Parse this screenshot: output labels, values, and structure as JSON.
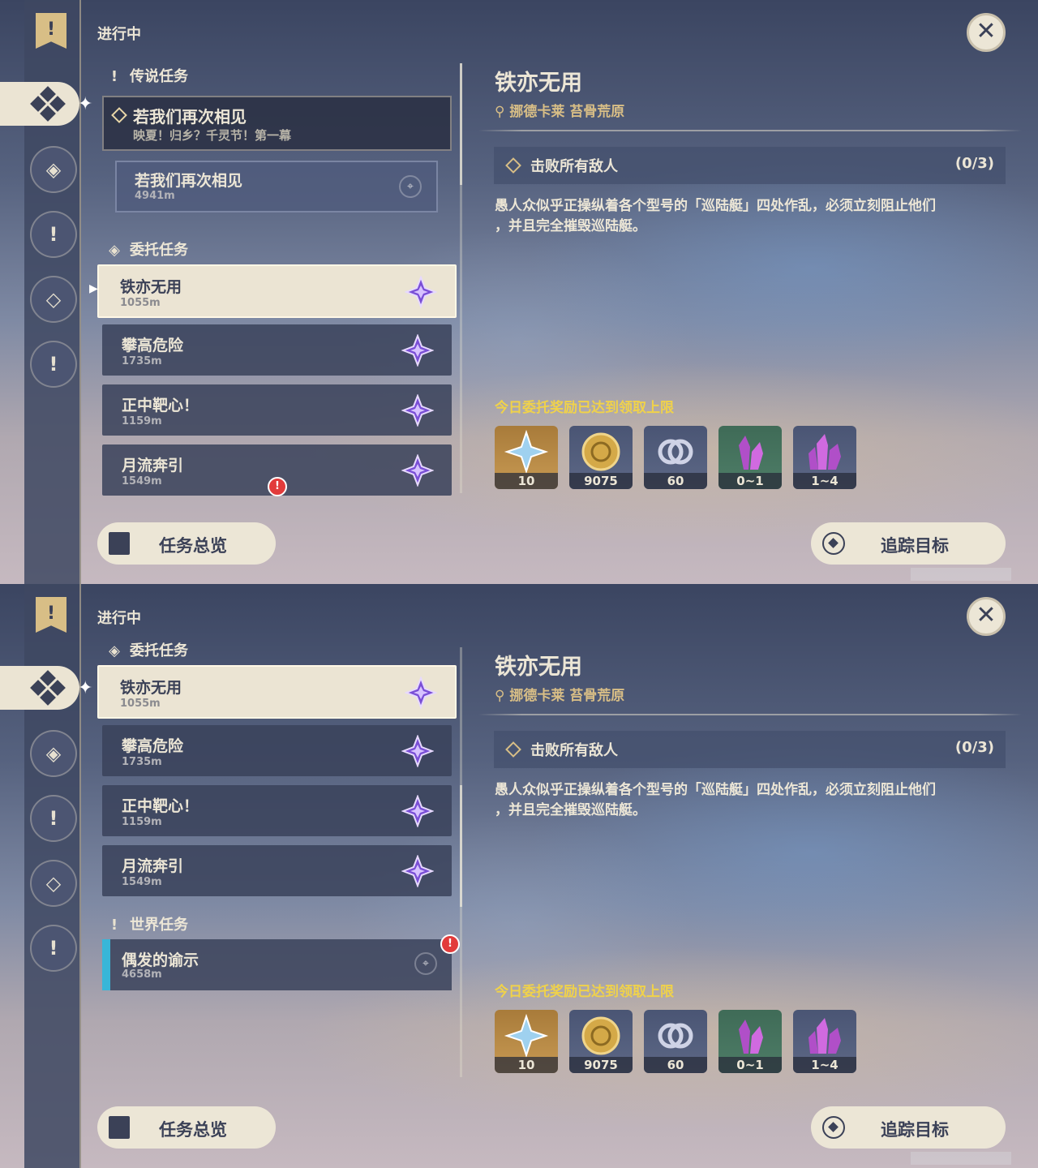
{
  "screens": [
    {
      "header": "进行中",
      "close_label": "✕",
      "rail_top_glyph": "!",
      "sections": {
        "legend": "传说任务",
        "commission": "委托任务"
      },
      "legend_quest": {
        "title": "若我们再次相见",
        "subtitle": "映夏！归乡？千灵节！第一幕",
        "step_title": "若我们再次相见",
        "step_distance": "4941m"
      },
      "commissions": [
        {
          "title": "铁亦无用",
          "distance": "1055m",
          "selected": true
        },
        {
          "title": "攀高危险",
          "distance": "1735m"
        },
        {
          "title": "正中靶心！",
          "distance": "1159m"
        },
        {
          "title": "月流奔引",
          "distance": "1549m"
        }
      ],
      "detail": {
        "title": "铁亦无用",
        "location": "挪德卡莱 苔骨荒原",
        "objective": "击败所有敌人",
        "objective_count": "(0/3)",
        "description_line1": "愚人众似乎正操纵着各个型号的「巡陆艇」四处作乱，必须立刻阻止他们",
        "description_line2": "，并且完全摧毁巡陆艇。",
        "limit_notice": "今日委托奖励已达到领取上限",
        "rewards": [
          {
            "icon": "primogem-icon",
            "amount": "10"
          },
          {
            "icon": "mora-coin-icon",
            "amount": "9075"
          },
          {
            "icon": "fellowship-icon",
            "amount": "60"
          },
          {
            "icon": "crystal-small-icon",
            "amount": "0~1"
          },
          {
            "icon": "crystal-large-icon",
            "amount": "1~4"
          }
        ]
      },
      "buttons": {
        "overview": "任务总览",
        "track": "追踪目标"
      }
    },
    {
      "header": "进行中",
      "close_label": "✕",
      "rail_top_glyph": "!",
      "sections": {
        "commission": "委托任务",
        "world": "世界任务"
      },
      "commissions": [
        {
          "title": "铁亦无用",
          "distance": "1055m",
          "selected": true
        },
        {
          "title": "攀高危险",
          "distance": "1735m"
        },
        {
          "title": "正中靶心！",
          "distance": "1159m"
        },
        {
          "title": "月流奔引",
          "distance": "1549m"
        }
      ],
      "world_quest": {
        "title": "偶发的谕示",
        "distance": "4658m"
      },
      "detail": {
        "title": "铁亦无用",
        "location": "挪德卡莱 苔骨荒原",
        "objective": "击败所有敌人",
        "objective_count": "(0/3)",
        "description_line1": "愚人众似乎正操纵着各个型号的「巡陆艇」四处作乱，必须立刻阻止他们",
        "description_line2": "，并且完全摧毁巡陆艇。",
        "limit_notice": "今日委托奖励已达到领取上限",
        "rewards": [
          {
            "icon": "primogem-icon",
            "amount": "10"
          },
          {
            "icon": "mora-coin-icon",
            "amount": "9075"
          },
          {
            "icon": "fellowship-icon",
            "amount": "60"
          },
          {
            "icon": "crystal-small-icon",
            "amount": "0~1"
          },
          {
            "icon": "crystal-large-icon",
            "amount": "1~4"
          }
        ]
      },
      "buttons": {
        "overview": "任务总览",
        "track": "追踪目标"
      }
    }
  ],
  "colors": {
    "accent_gold": "#d8be86",
    "limit_yellow": "#f0d24a",
    "card_dark": "#3a425a",
    "card_selected": "#ebe4d3",
    "world_bar": "#38b6d8"
  }
}
